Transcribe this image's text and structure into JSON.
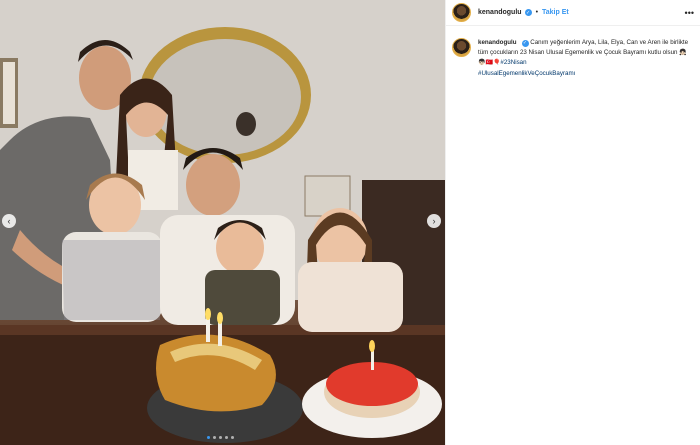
{
  "post": {
    "username": "kenandogulu",
    "follow_label": "Takip Et",
    "separator": "•",
    "more_label": "•••",
    "caption_text": "Canım yeğenlerim Arya, Lila, Elya, Can ve Aren ile birlikte tüm çocukların 23 Nisan Ulusal Egemenlik ve Çocuk Bayramı kutlu olsun",
    "caption_emoji": "👧🏻👦🏻🇹🇷🎈",
    "hashtags": [
      "#23Nisan",
      "#UlusalEgemenlikVeÇocukBayramı"
    ]
  },
  "carousel": {
    "prev_icon": "‹",
    "next_icon": "›",
    "dot_count": 5,
    "active_dot": 0
  },
  "colors": {
    "accent": "#3897f0",
    "hashtag": "#00376b",
    "text": "#262626"
  }
}
